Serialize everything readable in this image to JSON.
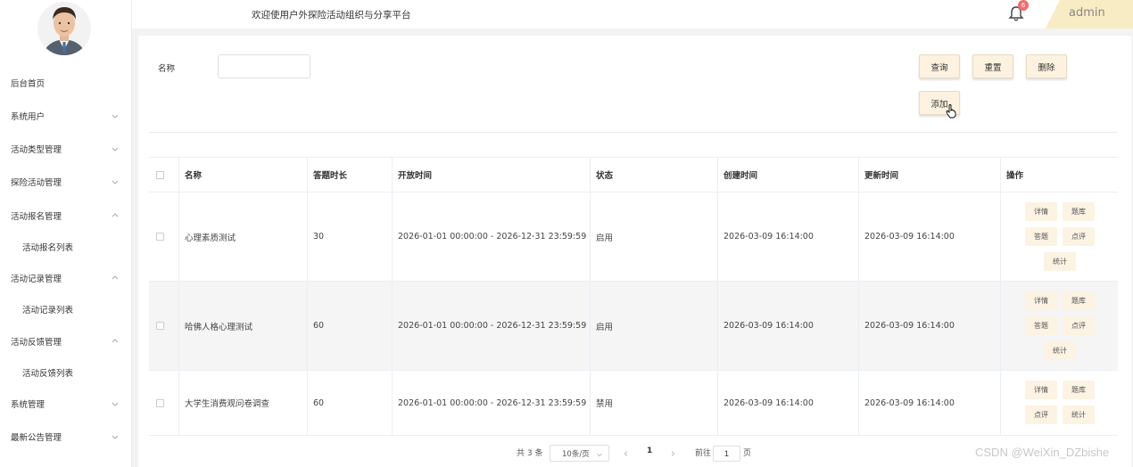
{
  "header": {
    "welcome": "欢迎使用户外探险活动组织与分享平台",
    "notification_count": "6",
    "username": "admin"
  },
  "sidebar": {
    "items": [
      {
        "label": "后台首页",
        "chevron": ""
      },
      {
        "label": "系统用户",
        "chevron": "down"
      },
      {
        "label": "活动类型管理",
        "chevron": "down"
      },
      {
        "label": "探险活动管理",
        "chevron": "down"
      },
      {
        "label": "活动报名管理",
        "chevron": "up"
      },
      {
        "label": "活动报名列表",
        "chevron": ""
      },
      {
        "label": "活动记录管理",
        "chevron": "up"
      },
      {
        "label": "活动记录列表",
        "chevron": ""
      },
      {
        "label": "活动反馈管理",
        "chevron": "up"
      },
      {
        "label": "活动反馈列表",
        "chevron": ""
      },
      {
        "label": "系统管理",
        "chevron": "down"
      },
      {
        "label": "最新公告管理",
        "chevron": "down"
      }
    ]
  },
  "search": {
    "label": "名称",
    "value": "",
    "placeholder": ""
  },
  "toolbar": {
    "query": "查询",
    "reset": "重置",
    "delete": "删除",
    "add": "添加"
  },
  "table": {
    "headers": [
      "名称",
      "答题时长",
      "开放时间",
      "状态",
      "创建时间",
      "更新时间",
      "操作"
    ],
    "rows": [
      {
        "name": "心理素质测试",
        "duration": "30",
        "open_time": "2026-01-01 00:00:00 - 2026-12-31 23:59:59",
        "status": "启用",
        "created": "2026-03-09 16:14:00",
        "updated": "2026-03-09 16:14:00",
        "actions": [
          "详情",
          "题库",
          "答题",
          "点评",
          "统计"
        ]
      },
      {
        "name": "哈佛人格心理测试",
        "duration": "60",
        "open_time": "2026-01-01 00:00:00 - 2026-12-31 23:59:59",
        "status": "启用",
        "created": "2026-03-09 16:14:00",
        "updated": "2026-03-09 16:14:00",
        "actions": [
          "详情",
          "题库",
          "答题",
          "点评",
          "统计"
        ]
      },
      {
        "name": "大学生消费观问卷调查",
        "duration": "60",
        "open_time": "2026-01-01 00:00:00 - 2026-12-31 23:59:59",
        "status": "禁用",
        "created": "2026-03-09 16:14:00",
        "updated": "2026-03-09 16:14:00",
        "actions": [
          "详情",
          "题库",
          "点评",
          "统计"
        ]
      }
    ]
  },
  "pagination": {
    "total": "共 3 条",
    "page_size": "10条/页",
    "current_page": "1",
    "goto_label": "前往",
    "goto_value": "1",
    "page_suffix": "页"
  },
  "watermark": "CSDN @WeiXin_DZbishe",
  "colors": {
    "accent": "#f8ecc4",
    "button_bg": "#fcf2df",
    "badge": "#f56c6c"
  }
}
